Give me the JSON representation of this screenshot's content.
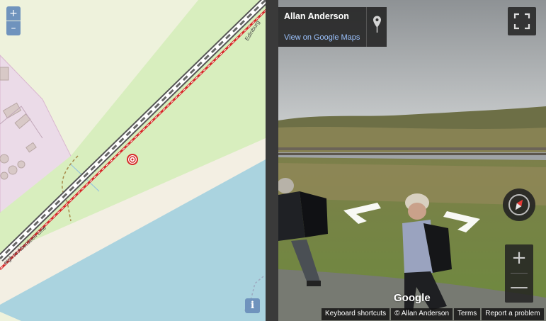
{
  "map": {
    "zoom_in_label": "+",
    "zoom_out_label": "–",
    "info_label": "i",
    "road_label_lower": "eigh to Aberdeen Line",
    "road_label_upper": "Edinburg",
    "colors": {
      "field": "#eef2dc",
      "grass": "#d8eebe",
      "industrial": "#ebdbe8",
      "sand": "#f3efe3",
      "water": "#aad3df",
      "rail": "#d62828",
      "road_casing": "#555555",
      "road_fill": "#ffffff",
      "control": "#6f93bd"
    }
  },
  "streetview": {
    "place_title": "Allan Anderson",
    "map_link": "View on Google Maps",
    "zoom_in_label": "+",
    "zoom_out_label": "—",
    "logo": "Google",
    "footer": {
      "shortcuts": "Keyboard shortcuts",
      "copyright": "© Allan Anderson",
      "terms": "Terms",
      "report": "Report a problem"
    }
  }
}
